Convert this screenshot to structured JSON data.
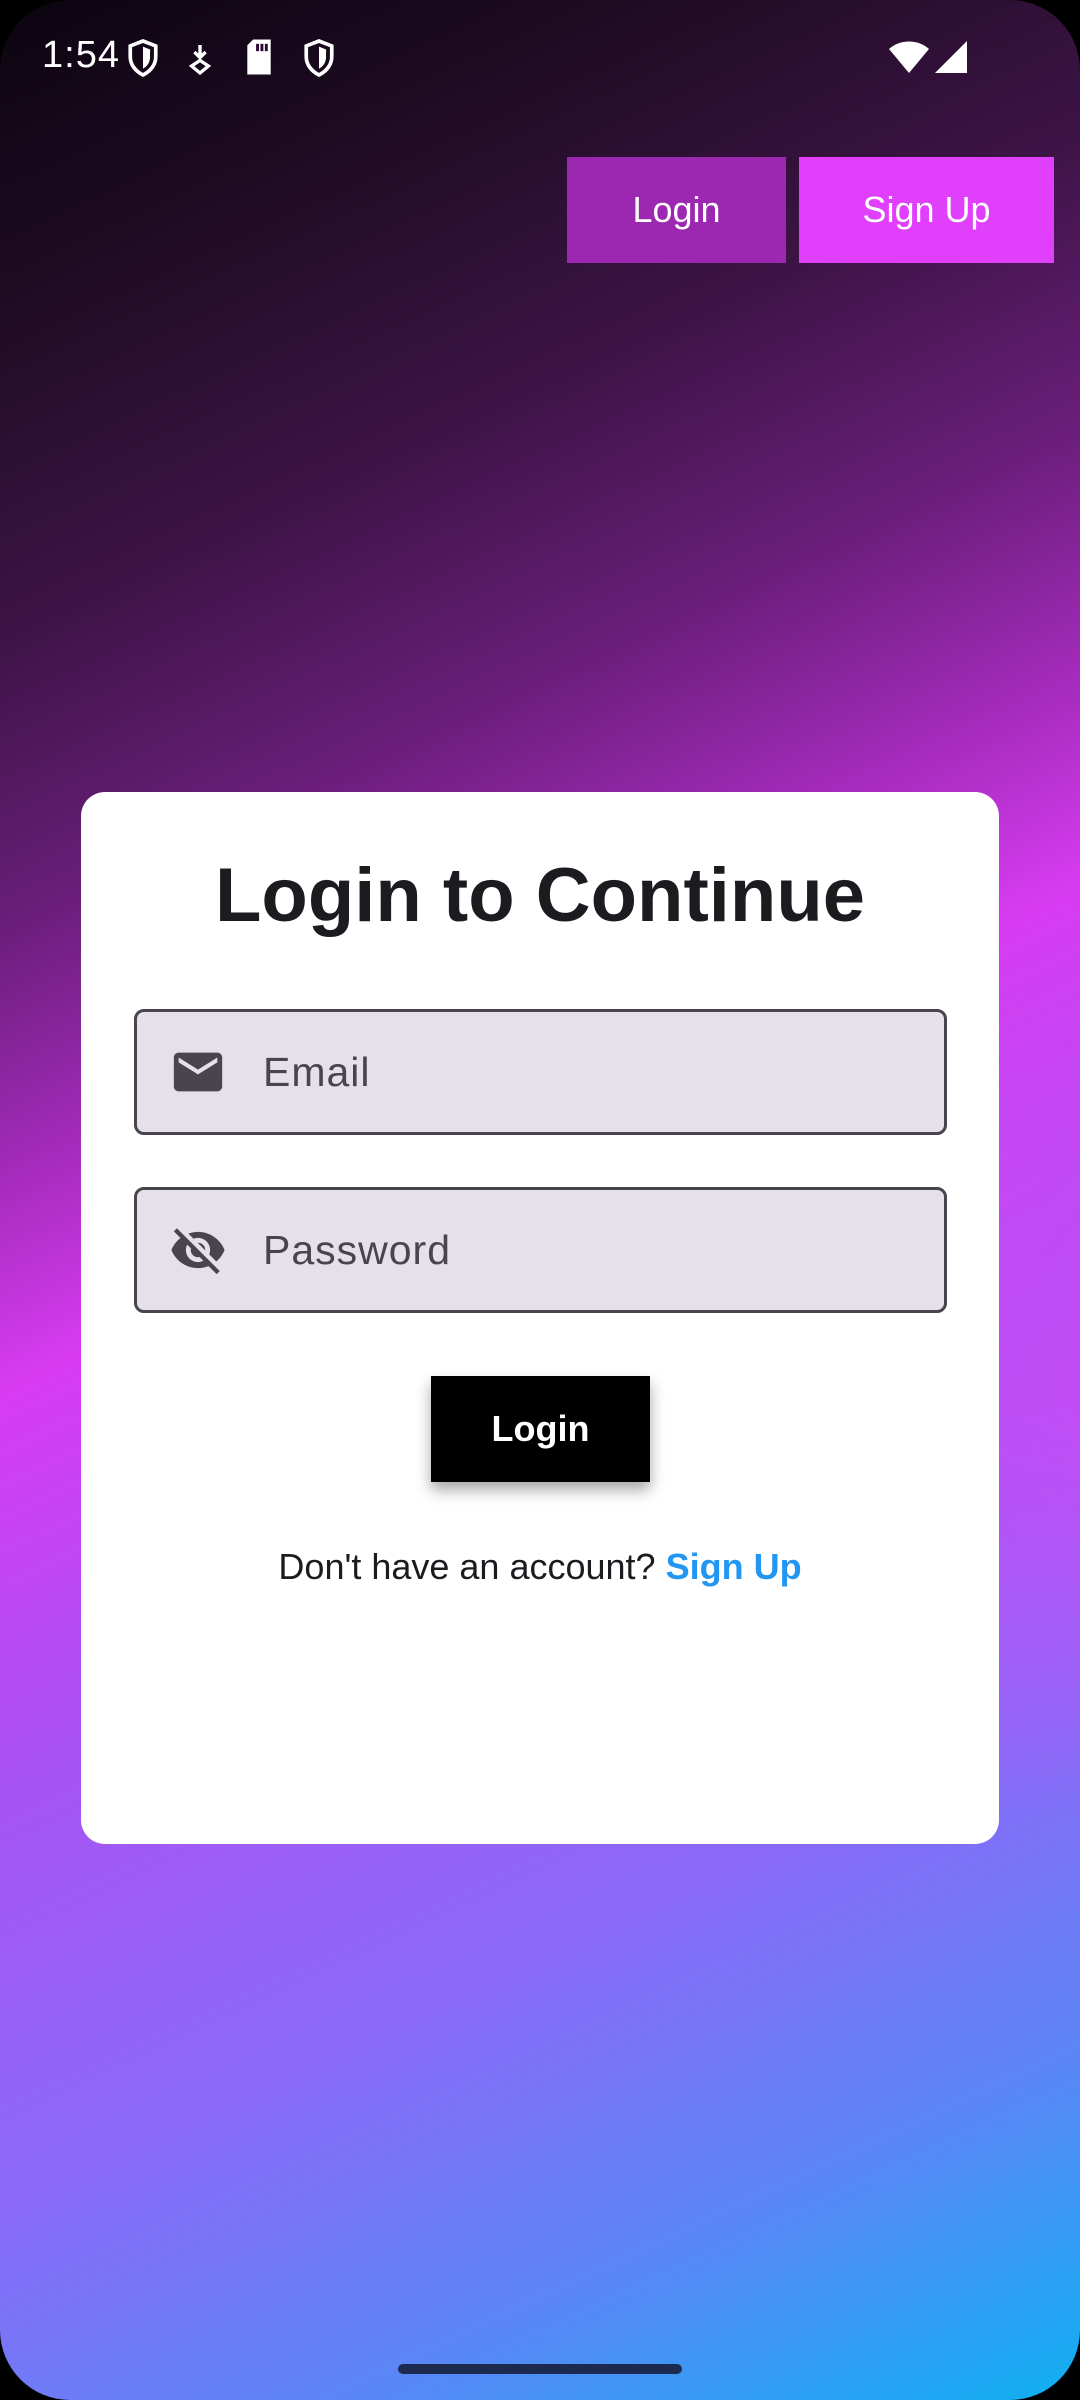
{
  "status_bar": {
    "time": "1:54",
    "icons": [
      "shield-icon",
      "download-icon",
      "sd-card-icon",
      "shield-icon",
      "wifi-icon",
      "signal-icon"
    ]
  },
  "header": {
    "login_label": "Login",
    "signup_label": "Sign Up"
  },
  "card": {
    "title": "Login to Continue",
    "email_placeholder": "Email",
    "password_placeholder": "Password",
    "login_label": "Login",
    "no_account_text": "Don't have an account?",
    "signup_link": "Sign Up"
  },
  "colors": {
    "login_top": "#9c27b0",
    "signup_top": "#e040fb",
    "link": "#2196f3",
    "field_bg": "#e6e0e9"
  }
}
